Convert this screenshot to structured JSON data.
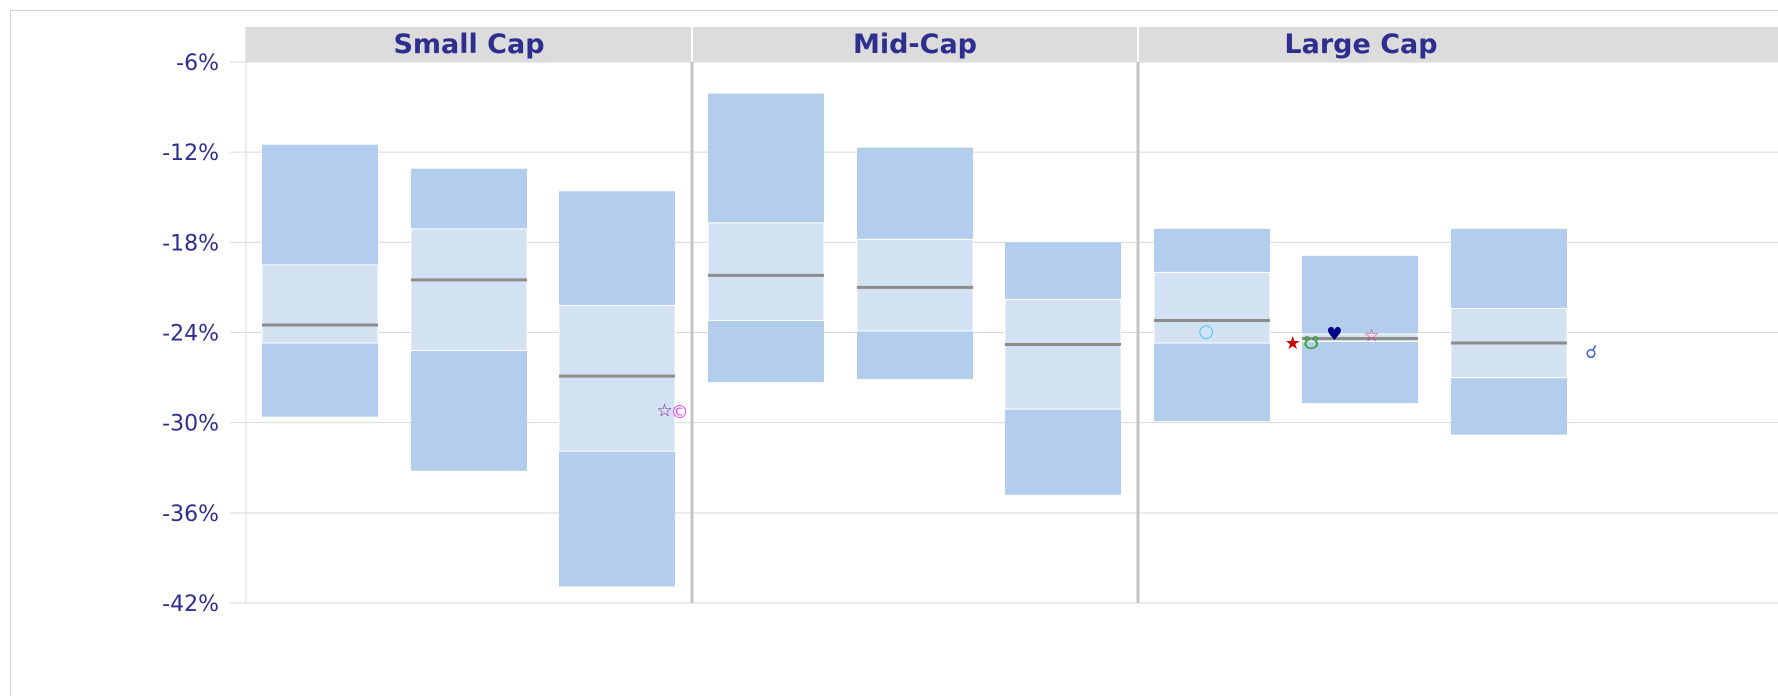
{
  "chart_data": {
    "type": "box",
    "panels": [
      "Small Cap",
      "Mid-Cap",
      "Large Cap"
    ],
    "y_ticks": [
      "-6%",
      "-12%",
      "-18%",
      "-24%",
      "-30%",
      "-36%",
      "-42%"
    ],
    "ylim": [
      -42,
      -6
    ],
    "grid": true,
    "colors": {
      "panel_header_bg": "#dcdcdc",
      "panel_header_text": "#2e2e8f",
      "tick_text": "#2e2e8f",
      "outer_band": "#b3ceec",
      "inner_band": "#d3e2f3",
      "median": "#8c8c8c",
      "grid": "#d9d9d9",
      "divider": "#c4c4c4"
    },
    "boxes": [
      {
        "panel": 0,
        "slot": 0,
        "p05": -29.6,
        "p25": -24.7,
        "median": -23.5,
        "p75": -19.5,
        "p95": -11.5
      },
      {
        "panel": 0,
        "slot": 1,
        "p05": -33.2,
        "p25": -25.2,
        "median": -20.5,
        "p75": -17.1,
        "p95": -13.1
      },
      {
        "panel": 0,
        "slot": 2,
        "p05": -40.9,
        "p25": -31.9,
        "median": -26.9,
        "p75": -22.2,
        "p95": -14.6
      },
      {
        "panel": 1,
        "slot": 0,
        "p05": -27.3,
        "p25": -23.2,
        "median": -20.2,
        "p75": -16.7,
        "p95": -8.1
      },
      {
        "panel": 1,
        "slot": 1,
        "p05": -27.1,
        "p25": -23.9,
        "median": -21.0,
        "p75": -17.8,
        "p95": -11.7
      },
      {
        "panel": 1,
        "slot": 2,
        "p05": -34.8,
        "p25": -29.1,
        "median": -24.8,
        "p75": -21.8,
        "p95": -18.0
      },
      {
        "panel": 2,
        "slot": 0,
        "p05": -29.9,
        "p25": -24.7,
        "median": -23.2,
        "p75": -20.0,
        "p95": -17.1
      },
      {
        "panel": 2,
        "slot": 1,
        "p05": -28.7,
        "p25": -24.6,
        "median": -24.4,
        "p75": -24.1,
        "p95": -18.9
      },
      {
        "panel": 2,
        "slot": 2,
        "p05": -30.8,
        "p25": -27.0,
        "median": -24.7,
        "p75": -22.4,
        "p95": -17.1
      }
    ],
    "markers": [
      {
        "panel": 0,
        "slot": 2,
        "offset": 0.41,
        "value": -29.2,
        "glyph": "☆",
        "color": "#7b1fa2",
        "name": "star-outline-marker"
      },
      {
        "panel": 0,
        "slot": 2,
        "offset": 0.54,
        "value": -29.3,
        "glyph": "©",
        "color": "#e040fb",
        "name": "copyright-marker"
      },
      {
        "panel": 2,
        "slot": 0,
        "offset": -0.05,
        "value": -23.9,
        "glyph": "○",
        "color": "#4fc3f7",
        "name": "circle-marker"
      },
      {
        "panel": 2,
        "slot": 1,
        "offset": -0.58,
        "value": -24.7,
        "glyph": "★",
        "color": "#cc0000",
        "name": "red-star-marker"
      },
      {
        "panel": 2,
        "slot": 1,
        "offset": -0.42,
        "value": -24.7,
        "glyph": "☋",
        "color": "#2e9e2e",
        "name": "green-symbol-marker"
      },
      {
        "panel": 2,
        "slot": 1,
        "offset": -0.22,
        "value": -24.1,
        "glyph": "♥",
        "color": "#00008b",
        "name": "heart-marker"
      },
      {
        "panel": 2,
        "slot": 1,
        "offset": 0.1,
        "value": -24.2,
        "glyph": "☆",
        "color": "#e0408a",
        "name": "pink-star-marker"
      },
      {
        "panel": 2,
        "slot": 2,
        "offset": 0.71,
        "value": -25.3,
        "glyph": "☌",
        "color": "#4466cc",
        "name": "blue-symbol-marker"
      }
    ]
  }
}
